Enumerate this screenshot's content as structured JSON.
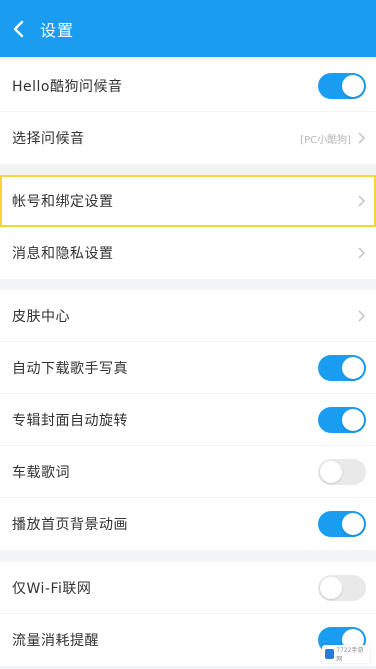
{
  "header": {
    "title": "设置"
  },
  "groups": [
    {
      "items": [
        {
          "label": "Hello酷狗问候音",
          "control": "toggle",
          "on": true
        },
        {
          "label": "选择问候音",
          "control": "chevron",
          "value": "[PC小酷狗]"
        }
      ]
    },
    {
      "items": [
        {
          "label": "帐号和绑定设置",
          "control": "chevron"
        },
        {
          "label": "消息和隐私设置",
          "control": "chevron"
        }
      ]
    },
    {
      "items": [
        {
          "label": "皮肤中心",
          "control": "chevron"
        },
        {
          "label": "自动下载歌手写真",
          "control": "toggle",
          "on": true
        },
        {
          "label": "专辑封面自动旋转",
          "control": "toggle",
          "on": true
        },
        {
          "label": "车载歌词",
          "control": "toggle",
          "on": false
        },
        {
          "label": "播放首页背景动画",
          "control": "toggle",
          "on": true
        }
      ]
    },
    {
      "items": [
        {
          "label": "仅Wi-Fi联网",
          "control": "toggle",
          "on": false
        },
        {
          "label": "流量消耗提醒",
          "control": "toggle",
          "on": true
        }
      ]
    }
  ],
  "watermark": {
    "text": "7722手游网"
  },
  "colors": {
    "accent": "#1a9df0",
    "highlight": "#f5d53a"
  }
}
